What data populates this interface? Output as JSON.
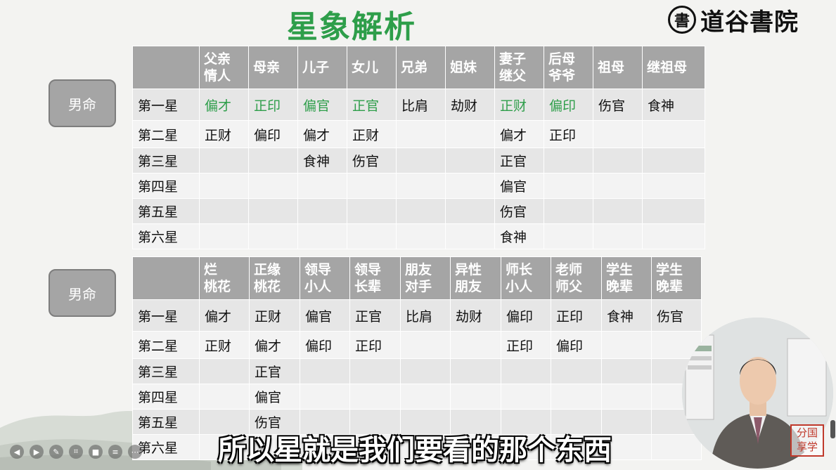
{
  "title": "星象解析",
  "brand": {
    "icon_char": "書",
    "name": "道谷書院"
  },
  "table1": {
    "side_label": "男命",
    "columns": [
      [
        "父亲",
        "情人"
      ],
      [
        "母亲",
        ""
      ],
      [
        "儿子",
        ""
      ],
      [
        "女儿",
        ""
      ],
      [
        "兄弟",
        ""
      ],
      [
        "姐妹",
        ""
      ],
      [
        "妻子",
        "继父"
      ],
      [
        "后母",
        "爷爷"
      ],
      [
        "祖母",
        ""
      ],
      [
        "继祖母",
        ""
      ]
    ],
    "rows": [
      {
        "label": "第一星",
        "cells": [
          "偏才",
          "正印",
          "偏官",
          "正官",
          "比肩",
          "劫财",
          "正财",
          "偏印",
          "伤官",
          "食神"
        ]
      },
      {
        "label": "第二星",
        "cells": [
          "正财",
          "偏印",
          "偏才",
          "正财",
          "",
          "",
          "偏才",
          "正印",
          "",
          ""
        ]
      },
      {
        "label": "第三星",
        "cells": [
          "",
          "",
          "食神",
          "伤官",
          "",
          "",
          "正官",
          "",
          "",
          ""
        ]
      },
      {
        "label": "第四星",
        "cells": [
          "",
          "",
          "",
          "",
          "",
          "",
          "偏官",
          "",
          "",
          ""
        ]
      },
      {
        "label": "第五星",
        "cells": [
          "",
          "",
          "",
          "",
          "",
          "",
          "伤官",
          "",
          "",
          ""
        ]
      },
      {
        "label": "第六星",
        "cells": [
          "",
          "",
          "",
          "",
          "",
          "",
          "食神",
          "",
          "",
          ""
        ]
      }
    ],
    "highlight_color": "#2e9e4a"
  },
  "table2": {
    "side_label": "男命",
    "columns": [
      [
        "烂",
        "桃花"
      ],
      [
        "正缘",
        "桃花"
      ],
      [
        "领导",
        "小人"
      ],
      [
        "领导",
        "长辈"
      ],
      [
        "朋友",
        "对手"
      ],
      [
        "异性",
        "朋友"
      ],
      [
        "师长",
        "小人"
      ],
      [
        "老师",
        "师父"
      ],
      [
        "学生",
        "晚辈"
      ],
      [
        "学生",
        "晚辈"
      ]
    ],
    "rows": [
      {
        "label": "第一星",
        "cells": [
          "偏才",
          "正财",
          "偏官",
          "正官",
          "比肩",
          "劫财",
          "偏印",
          "正印",
          "食神",
          "伤官"
        ]
      },
      {
        "label": "第二星",
        "cells": [
          "正财",
          "偏才",
          "偏印",
          "正印",
          "",
          "",
          "正印",
          "偏印",
          "",
          ""
        ]
      },
      {
        "label": "第三星",
        "cells": [
          "",
          "正官",
          "",
          "",
          "",
          "",
          "",
          "",
          "",
          ""
        ]
      },
      {
        "label": "第四星",
        "cells": [
          "",
          "偏官",
          "",
          "",
          "",
          "",
          "",
          "",
          "",
          ""
        ]
      },
      {
        "label": "第五星",
        "cells": [
          "",
          "伤官",
          "",
          "",
          "",
          "",
          "",
          "",
          "",
          ""
        ]
      },
      {
        "label": "第六星",
        "cells": [
          "",
          "",
          "",
          "",
          "",
          "",
          "",
          "",
          "",
          ""
        ]
      }
    ]
  },
  "stamp": [
    "分国",
    "享学"
  ],
  "subtitle": "所以星就是我们要看的那个东西",
  "player_icons": [
    "prev-icon",
    "next-icon",
    "pen-icon",
    "screenshot-icon",
    "camera-icon",
    "chat-icon",
    "more-icon"
  ],
  "colors": {
    "header_gray": "#a5a5a5",
    "row_dark": "#e6e6e6",
    "row_light": "#f3f3f3",
    "title_green": "#2e9e4a"
  }
}
